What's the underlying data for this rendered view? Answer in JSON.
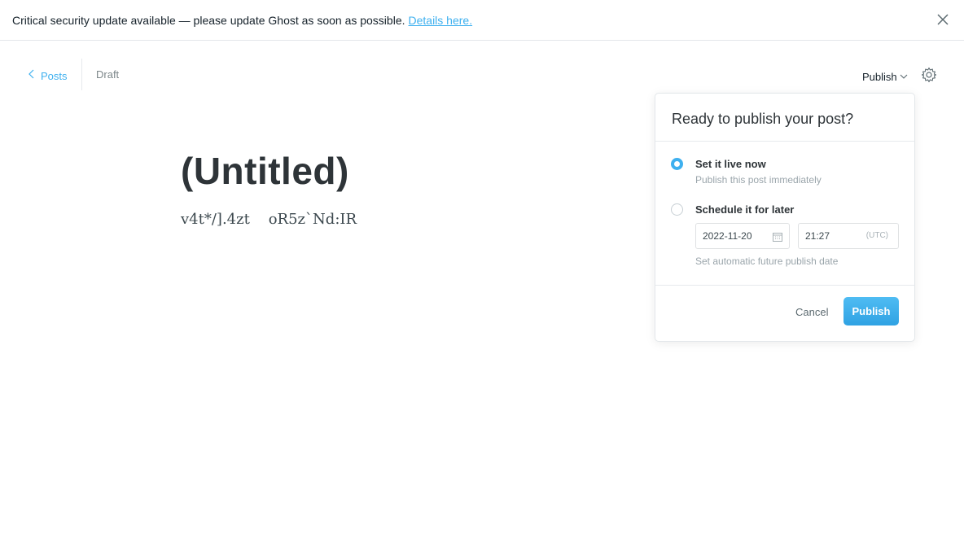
{
  "banner": {
    "message": "Critical security update available — please update Ghost as soon as possible.",
    "link_text": "Details here.",
    "close_icon": "close-icon"
  },
  "editor_header": {
    "back_label": "Posts",
    "back_icon": "chevron-left-icon",
    "status": "Draft",
    "publish_label": "Publish",
    "publish_icon": "chevron-down-icon",
    "settings_icon": "gear-icon"
  },
  "post": {
    "title": "(Untitled)",
    "body": "v4t*/].4zt    oR5z`Nd:IR"
  },
  "publish_menu": {
    "heading": "Ready to publish your post?",
    "options": [
      {
        "label": "Set it live now",
        "description": "Publish this post immediately",
        "selected": true
      },
      {
        "label": "Schedule it for later",
        "description": "Set automatic future publish date",
        "selected": false
      }
    ],
    "schedule": {
      "date": "2022-11-20",
      "time": "21:27",
      "timezone": "(UTC)",
      "calendar_icon": "calendar-icon"
    },
    "cancel_label": "Cancel",
    "publish_label": "Publish"
  },
  "colors": {
    "accent": "#3eb0ef",
    "text": "#15212a",
    "muted": "#7d878a",
    "border": "#e3e7ea"
  }
}
